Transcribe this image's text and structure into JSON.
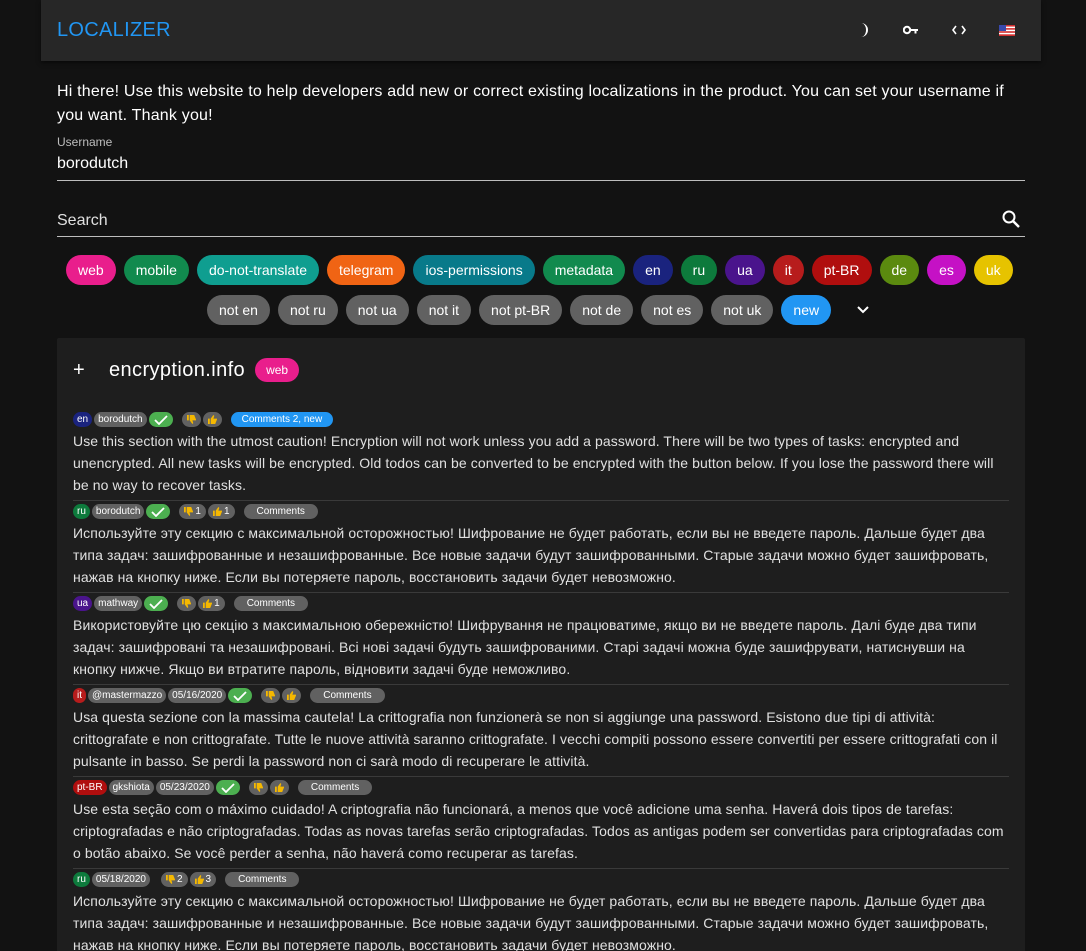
{
  "appbar": {
    "title": "LOCALIZER",
    "icons": [
      "dark-mode-icon",
      "key-icon",
      "code-icon",
      "us-flag-icon"
    ]
  },
  "intro": "Hi there! Use this website to help developers add new or correct existing localizations in the product. You can set your username if you want. Thank you!",
  "username": {
    "label": "Username",
    "value": "borodutch"
  },
  "search": {
    "placeholder": "Search"
  },
  "filter_tags": [
    {
      "label": "web",
      "color": "#e91e8c"
    },
    {
      "label": "mobile",
      "color": "#118a4e"
    },
    {
      "label": "do-not-translate",
      "color": "#0f9e90"
    },
    {
      "label": "telegram",
      "color": "#f06414"
    },
    {
      "label": "ios-permissions",
      "color": "#087a8a"
    },
    {
      "label": "metadata",
      "color": "#118a4e"
    },
    {
      "label": "en",
      "color": "#1a237e"
    },
    {
      "label": "ru",
      "color": "#0d7a3c"
    },
    {
      "label": "ua",
      "color": "#4a148c"
    },
    {
      "label": "it",
      "color": "#b71c1c"
    },
    {
      "label": "pt-BR",
      "color": "#b00e0e"
    },
    {
      "label": "de",
      "color": "#5b8a0f"
    },
    {
      "label": "es",
      "color": "#c511c5"
    },
    {
      "label": "uk",
      "color": "#e6c300"
    }
  ],
  "filter_not": [
    {
      "label": "not en"
    },
    {
      "label": "not ru"
    },
    {
      "label": "not ua"
    },
    {
      "label": "not it"
    },
    {
      "label": "not pt-BR"
    },
    {
      "label": "not de"
    },
    {
      "label": "not es"
    },
    {
      "label": "not uk"
    }
  ],
  "filter_new": {
    "label": "new",
    "color": "#2196f3"
  },
  "colors": {
    "accent": "#2196f3",
    "check": "#4caf50",
    "chip_gray": "#616161"
  },
  "card": {
    "key": "encryption.info",
    "tag": "web",
    "entries": [
      {
        "lang": "en",
        "lang_color": "#1a237e",
        "user": "borodutch",
        "date": "",
        "down": "",
        "up": "",
        "comments": "Comments 2, new",
        "comments_new": true,
        "approved": true,
        "text": "Use this section with the utmost caution! Encryption will not work unless you add a password. There will be two types of tasks: encrypted and unencrypted. All new tasks will be encrypted. Old todos can be converted to be encrypted with the button below. If you lose the password there will be no way to recover tasks."
      },
      {
        "lang": "ru",
        "lang_color": "#0d7a3c",
        "user": "borodutch",
        "date": "",
        "down": "1",
        "up": "1",
        "comments": "Comments",
        "comments_new": false,
        "approved": true,
        "text": "Используйте эту секцию с максимальной осторожностью! Шифрование не будет работать, если вы не введете пароль. Дальше будет два типа задач: зашифрованные и незашифрованные. Все новые задачи будут зашифрованными. Старые задачи можно будет зашифровать, нажав на кнопку ниже. Если вы потеряете пароль, восстановить задачи будет невозможно."
      },
      {
        "lang": "ua",
        "lang_color": "#4a148c",
        "user": "mathway",
        "date": "",
        "down": "",
        "up": "1",
        "comments": "Comments",
        "comments_new": false,
        "approved": true,
        "text": "Використовуйте цю секцію з максимальною обережністю! Шифрування не працюватиме, якщо ви не введете пароль. Далі буде два типи задач: зашифровані та незашифровані. Всі нові задачі будуть зашифрованими. Старі задачі можна буде зашифрувати, натиснувши на кнопку нижче. Якщо ви втратите пароль, відновити задачі буде неможливо."
      },
      {
        "lang": "it",
        "lang_color": "#b71c1c",
        "user": "@mastermazzo",
        "date": "05/16/2020",
        "down": "",
        "up": "",
        "comments": "Comments",
        "comments_new": false,
        "approved": true,
        "text": "Usa questa sezione con la massima cautela! La crittografia non funzionerà se non si aggiunge una password. Esistono due tipi di attività: crittografate e non crittografate. Tutte le nuove attività saranno crittografate. I vecchi compiti possono essere convertiti per essere crittografati con il pulsante in basso. Se perdi la password non ci sarà modo di recuperare le attività."
      },
      {
        "lang": "pt-BR",
        "lang_color": "#b00e0e",
        "user": "gkshiota",
        "date": "05/23/2020",
        "down": "",
        "up": "",
        "comments": "Comments",
        "comments_new": false,
        "approved": true,
        "text": "Use esta seção com o máximo cuidado! A criptografia não funcionará, a menos que você adicione uma senha. Haverá dois tipos de tarefas: criptografadas e não criptografadas. Todas as novas tarefas serão criptografadas. Todos as antigas podem ser convertidas para criptografadas com o botão abaixo. Se você perder a senha, não haverá como recuperar as tarefas."
      },
      {
        "lang": "ru",
        "lang_color": "#0d7a3c",
        "user": "",
        "date": "05/18/2020",
        "down": "2",
        "up": "3",
        "comments": "Comments",
        "comments_new": false,
        "approved": false,
        "text": "Используйте эту секцию с максимальной осторожностью! Шифрование не будет работать, если вы не введете пароль. Дальше будет два типа задач: зашифрованные и незашифрованные. Все новые задачи будут зашифрованными. Старые задачи можно будет зашифровать, нажав на кнопку ниже. Если вы потеряете пароль, восстановить задачи будет невозможно."
      }
    ]
  }
}
